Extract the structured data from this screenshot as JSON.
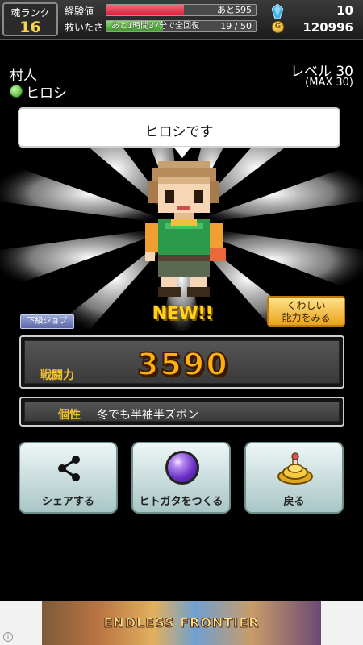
{
  "topbar": {
    "rank_label": "魂ランク",
    "rank_value": "16",
    "exp_label": "経験値",
    "exp_text": "あと595",
    "exp_fraction": 0.52,
    "rescue_label": "救いたさ",
    "rescue_text": "19 / 50",
    "rescue_subtext": "あと1時間37分で全回復",
    "rescue_fraction": 0.38,
    "gem_count": "10",
    "coin_symbol": "G",
    "coin_count": "120996"
  },
  "character": {
    "job": "村人",
    "name": "ヒロシ",
    "level": "レベル 30",
    "max_level": "(MAX 30)",
    "speech": "ヒロシです",
    "new_badge": "NEW!!",
    "job_tag": "下級ジョブ"
  },
  "details_button": {
    "line1": "くわしい",
    "line2": "能力をみる"
  },
  "power": {
    "label": "戦闘力",
    "value": "3590"
  },
  "trait": {
    "label": "個性",
    "value": "冬でも半袖半ズボン"
  },
  "actions": {
    "share": "シェアする",
    "make": "ヒトガタをつくる",
    "back": "戻る"
  },
  "ad": {
    "title": "ENDLESS FRONTIER",
    "info": "i"
  },
  "colors": {
    "exp_bar": "#d81d38",
    "rescue_bar": "#3c9a2a",
    "rank_value": "#f5d44a",
    "power_value": "#ffb010",
    "gold_label": "#f5c330"
  },
  "icons": [
    "gem-icon",
    "coin-icon",
    "green-dot-icon",
    "share-icon",
    "orb-icon",
    "gold-pile-icon"
  ]
}
